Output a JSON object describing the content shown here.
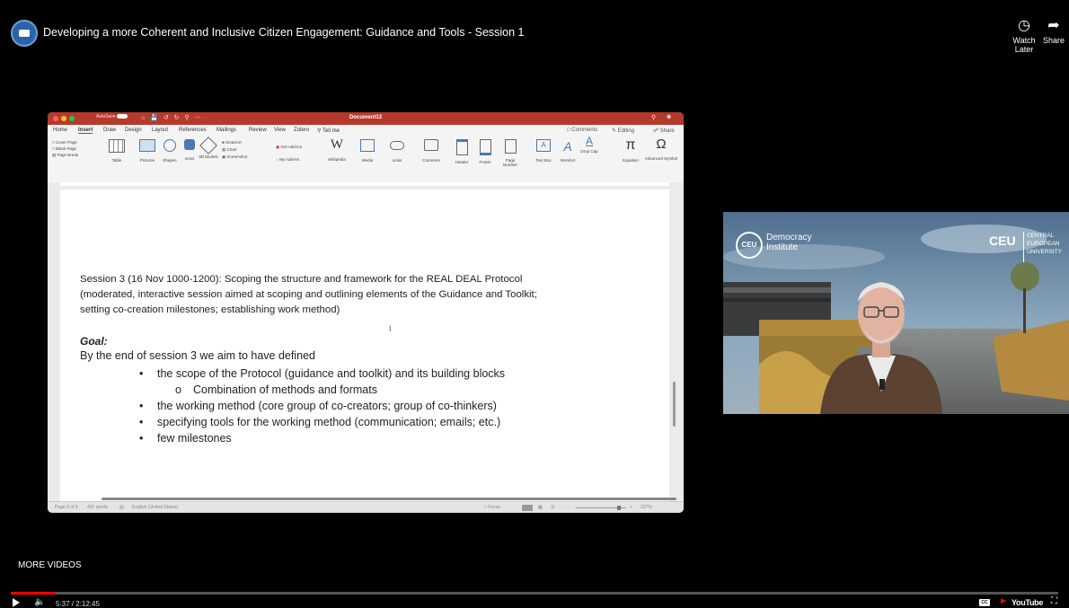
{
  "video": {
    "title": "Developing a more Coherent and Inclusive Citizen Engagement: Guidance and Tools - Session 1",
    "watch_later_label": "Watch Later",
    "share_label": "Share",
    "more_videos_label": "MORE VIDEOS",
    "time_display": "5:37 / 2:12:45",
    "progress_fraction": 0.042,
    "youtube_label": "YouTube",
    "accent_color": "#ff0000"
  },
  "word": {
    "document_title": "Document13",
    "autosave_label": "AutoSave",
    "tabs": [
      "Home",
      "Insert",
      "Draw",
      "Design",
      "Layout",
      "References",
      "Mailings",
      "Review",
      "View",
      "Zotero",
      "Tell me"
    ],
    "active_tab": "Insert",
    "comments_label": "Comments",
    "editing_label": "Editing",
    "share_label": "Share",
    "ribbon": {
      "cover_page": "Cover Page",
      "blank_page": "Blank Page",
      "page_break": "Page Break",
      "table": "Table",
      "pictures": "Pictures",
      "shapes": "Shapes",
      "icons": "Icons",
      "models_3d": "3D Models",
      "smartart": "SmartArt",
      "chart": "Chart",
      "screenshot": "Screenshot",
      "get_addins": "Get Add-ins",
      "my_addins": "My Add-ins",
      "wikipedia": "Wikipedia",
      "media": "Media",
      "links": "Links",
      "comment": "Comment",
      "header": "Header",
      "footer": "Footer",
      "page_number": "Page Number",
      "text_box": "Text Box",
      "wordart": "WordArt",
      "drop_cap": "Drop Cap",
      "equation": "Equation",
      "advanced_symbol": "Advanced Symbol"
    },
    "content": {
      "session_lines": [
        "Session 3 (16 Nov 1000-1200): Scoping the structure and framework for the REAL DEAL Protocol",
        "(moderated, interactive session aimed at scoping and outlining elements of the Guidance and Toolkit;",
        "setting co-creation milestones; establishing work method)"
      ],
      "goal_label": "Goal:",
      "goal_intro": "By the end of session 3 we aim to have defined",
      "bullets": [
        "the scope of the Protocol (guidance and toolkit) and its building blocks",
        "the working method (core group of co-creators; group of co-thinkers)",
        "specifying tools for the working method (communication; emails; etc.)",
        "few milestones"
      ],
      "sub_bullet": "Combination of methods and formats"
    },
    "status": {
      "page": "Page 3 of 3",
      "words": "491 words",
      "language": "English (United States)",
      "focus": "Focus",
      "zoom": "237%"
    }
  },
  "webcam": {
    "overlay_left_line1": "Democracy",
    "overlay_left_line2": "Institute",
    "logo_text": "CEU",
    "uni_line1": "CENTRAL",
    "uni_line2": "EUROPEAN",
    "uni_line3": "UNIVERSITY"
  }
}
